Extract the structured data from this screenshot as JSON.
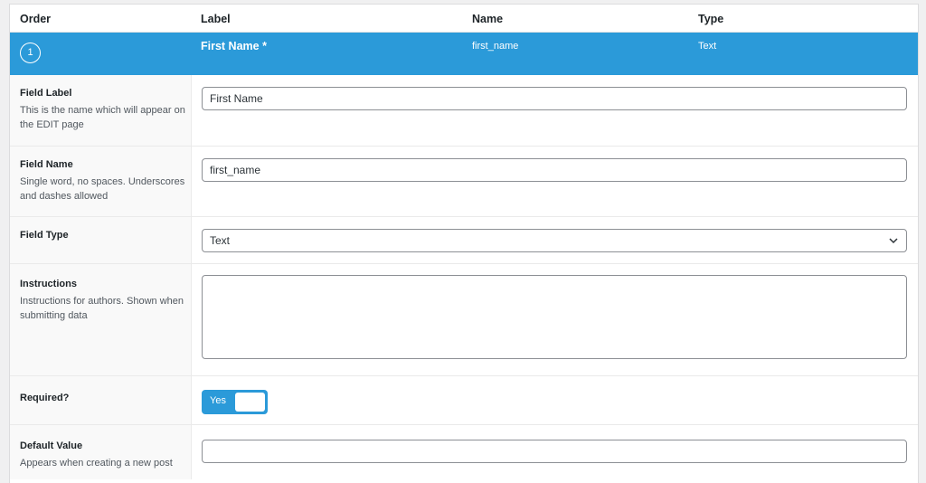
{
  "table": {
    "headers": [
      "Order",
      "Label",
      "Name",
      "Type"
    ]
  },
  "field": {
    "order": "1",
    "label": "First Name *",
    "name": "first_name",
    "type": "Text"
  },
  "settings": {
    "field_label": {
      "title": "Field Label",
      "desc": "This is the name which will appear on the EDIT page",
      "value": "First Name"
    },
    "field_name": {
      "title": "Field Name",
      "desc": "Single word, no spaces. Underscores and dashes allowed",
      "value": "first_name"
    },
    "field_type": {
      "title": "Field Type",
      "selected": "Text"
    },
    "instructions": {
      "title": "Instructions",
      "desc": "Instructions for authors. Shown when submitting data",
      "value": ""
    },
    "required": {
      "title": "Required?",
      "toggle_label": "Yes"
    },
    "default_value": {
      "title": "Default Value",
      "desc": "Appears when creating a new post",
      "value": ""
    }
  },
  "colors": {
    "accent": "#2b9ad9"
  }
}
